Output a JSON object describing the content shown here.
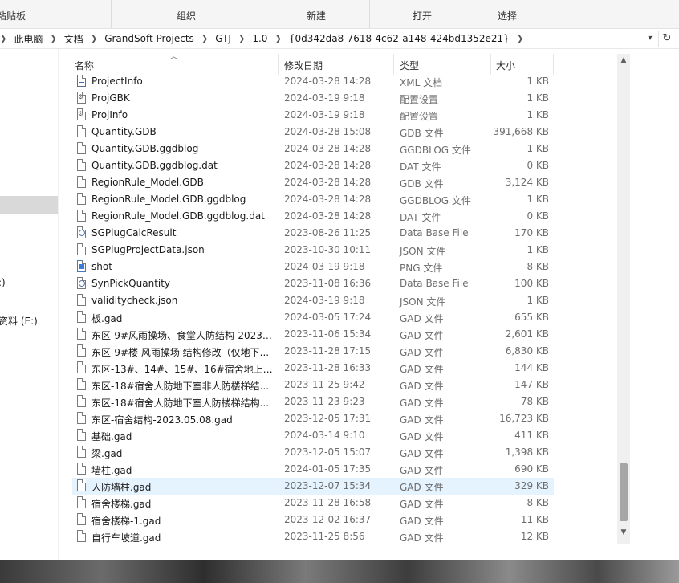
{
  "ribbon": {
    "groups": [
      "粘贴板",
      "组织",
      "新建",
      "打开",
      "选择"
    ]
  },
  "address": {
    "crumbs": [
      "此电脑",
      "文档",
      "GrandSoft Projects",
      "GTJ",
      "1.0",
      "{0d342da8-7618-4c62-a148-424bd1352e21}"
    ]
  },
  "nav": {
    "items": [
      ":)",
      "资料 (E:)"
    ]
  },
  "columns": {
    "name": "名称",
    "date": "修改日期",
    "type": "类型",
    "size": "大小"
  },
  "files": [
    {
      "name": "ProjectInfo",
      "date": "2024-03-28 14:28",
      "type": "XML 文档",
      "size": "1 KB",
      "icon": "xml-file-icon"
    },
    {
      "name": "ProjGBK",
      "date": "2024-03-19 9:18",
      "type": "配置设置",
      "size": "1 KB",
      "icon": "settings-file-icon"
    },
    {
      "name": "ProjInfo",
      "date": "2024-03-19 9:18",
      "type": "配置设置",
      "size": "1 KB",
      "icon": "settings-file-icon"
    },
    {
      "name": "Quantity.GDB",
      "date": "2024-03-28 15:08",
      "type": "GDB 文件",
      "size": "391,668 KB",
      "icon": "file-icon"
    },
    {
      "name": "Quantity.GDB.ggdblog",
      "date": "2024-03-28 14:28",
      "type": "GGDBLOG 文件",
      "size": "1 KB",
      "icon": "file-icon"
    },
    {
      "name": "Quantity.GDB.ggdblog.dat",
      "date": "2024-03-28 14:28",
      "type": "DAT 文件",
      "size": "0 KB",
      "icon": "file-icon"
    },
    {
      "name": "RegionRule_Model.GDB",
      "date": "2024-03-28 14:28",
      "type": "GDB 文件",
      "size": "3,124 KB",
      "icon": "file-icon"
    },
    {
      "name": "RegionRule_Model.GDB.ggdblog",
      "date": "2024-03-28 14:28",
      "type": "GGDBLOG 文件",
      "size": "1 KB",
      "icon": "file-icon"
    },
    {
      "name": "RegionRule_Model.GDB.ggdblog.dat",
      "date": "2024-03-28 14:28",
      "type": "DAT 文件",
      "size": "0 KB",
      "icon": "file-icon"
    },
    {
      "name": "SGPlugCalcResult",
      "date": "2023-08-26 11:25",
      "type": "Data Base File",
      "size": "170 KB",
      "icon": "database-file-icon"
    },
    {
      "name": "SGPlugProjectData.json",
      "date": "2023-10-30 10:11",
      "type": "JSON 文件",
      "size": "1 KB",
      "icon": "file-icon"
    },
    {
      "name": "shot",
      "date": "2024-03-19 9:18",
      "type": "PNG 文件",
      "size": "8 KB",
      "icon": "image-file-icon"
    },
    {
      "name": "SynPickQuantity",
      "date": "2023-11-08 16:36",
      "type": "Data Base File",
      "size": "100 KB",
      "icon": "database-file-icon"
    },
    {
      "name": "validitycheck.json",
      "date": "2024-03-19 9:18",
      "type": "JSON 文件",
      "size": "1 KB",
      "icon": "file-icon"
    },
    {
      "name": "板.gad",
      "date": "2024-03-05 17:24",
      "type": "GAD 文件",
      "size": "655 KB",
      "icon": "file-icon"
    },
    {
      "name": "东区-9#风雨操场、食堂人防结构-2023....",
      "date": "2023-11-06 15:34",
      "type": "GAD 文件",
      "size": "2,601 KB",
      "icon": "file-icon"
    },
    {
      "name": "东区-9#楼 风雨操场 结构修改（仅地下...",
      "date": "2023-11-28 17:15",
      "type": "GAD 文件",
      "size": "6,830 KB",
      "icon": "file-icon"
    },
    {
      "name": "东区-13#、14#、15#、16#宿舍地上楼...",
      "date": "2023-11-28 16:33",
      "type": "GAD 文件",
      "size": "144 KB",
      "icon": "file-icon"
    },
    {
      "name": "东区-18#宿舍人防地下室非人防楼梯结...",
      "date": "2023-11-25 9:42",
      "type": "GAD 文件",
      "size": "147 KB",
      "icon": "file-icon"
    },
    {
      "name": "东区-18#宿舍人防地下室人防楼梯结构...",
      "date": "2023-11-23 9:23",
      "type": "GAD 文件",
      "size": "78 KB",
      "icon": "file-icon"
    },
    {
      "name": "东区-宿舍结构-2023.05.08.gad",
      "date": "2023-12-05 17:31",
      "type": "GAD 文件",
      "size": "16,723 KB",
      "icon": "file-icon"
    },
    {
      "name": "基础.gad",
      "date": "2024-03-14 9:10",
      "type": "GAD 文件",
      "size": "411 KB",
      "icon": "file-icon"
    },
    {
      "name": "梁.gad",
      "date": "2023-12-05 15:07",
      "type": "GAD 文件",
      "size": "1,398 KB",
      "icon": "file-icon"
    },
    {
      "name": "墙柱.gad",
      "date": "2024-01-05 17:35",
      "type": "GAD 文件",
      "size": "690 KB",
      "icon": "file-icon"
    },
    {
      "name": "人防墙柱.gad",
      "date": "2023-12-07 15:34",
      "type": "GAD 文件",
      "size": "329 KB",
      "icon": "file-icon",
      "highlight": true
    },
    {
      "name": "宿舍楼梯.gad",
      "date": "2023-11-28 16:58",
      "type": "GAD 文件",
      "size": "8 KB",
      "icon": "file-icon"
    },
    {
      "name": "宿舍楼梯-1.gad",
      "date": "2023-12-02 16:37",
      "type": "GAD 文件",
      "size": "11 KB",
      "icon": "file-icon"
    },
    {
      "name": "自行车坡道.gad",
      "date": "2023-11-25 8:56",
      "type": "GAD 文件",
      "size": "12 KB",
      "icon": "file-icon"
    }
  ]
}
